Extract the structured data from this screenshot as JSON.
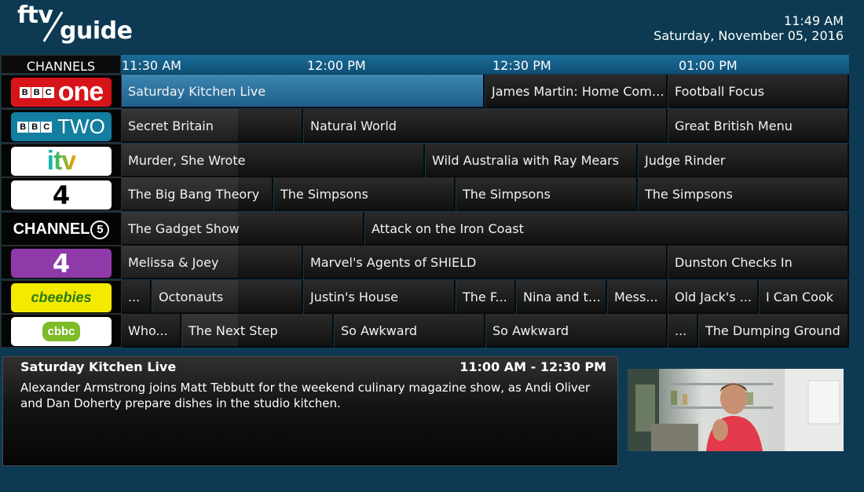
{
  "app": {
    "logo_top": "ftv",
    "logo_bottom": "guide"
  },
  "clock": {
    "time": "11:49 AM",
    "date": "Saturday, November 05, 2016"
  },
  "grid": {
    "channels_header": "CHANNELS",
    "times": [
      "11:30 AM",
      "12:00 PM",
      "12:30 PM",
      "01:00 PM"
    ],
    "rows": [
      {
        "channel": "BBC One",
        "logo": "bbc-one-logo",
        "programmes": [
          {
            "title": "Saturday Kitchen Live",
            "selected": true
          },
          {
            "title": "James Martin: Home Comfort..."
          },
          {
            "title": "Football Focus"
          }
        ]
      },
      {
        "channel": "BBC Two",
        "logo": "bbc-two-logo",
        "programmes": [
          {
            "title": "Secret Britain"
          },
          {
            "title": "Natural World"
          },
          {
            "title": "Great British Menu"
          }
        ]
      },
      {
        "channel": "ITV",
        "logo": "itv-logo",
        "programmes": [
          {
            "title": "Murder, She Wrote"
          },
          {
            "title": "Wild Australia with Ray Mears"
          },
          {
            "title": "Judge Rinder"
          }
        ]
      },
      {
        "channel": "Channel 4",
        "logo": "channel-4-logo",
        "programmes": [
          {
            "title": "The Big Bang Theory"
          },
          {
            "title": "The Simpsons"
          },
          {
            "title": "The Simpsons"
          },
          {
            "title": "The Simpsons"
          }
        ]
      },
      {
        "channel": "Channel 5",
        "logo": "channel-5-logo",
        "programmes": [
          {
            "title": "The Gadget Show"
          },
          {
            "title": "Attack on the Iron Coast"
          }
        ]
      },
      {
        "channel": "E4",
        "logo": "e4-logo",
        "programmes": [
          {
            "title": "Melissa & Joey"
          },
          {
            "title": "Marvel's Agents of SHIELD"
          },
          {
            "title": "Dunston Checks In"
          }
        ]
      },
      {
        "channel": "CBeebies",
        "logo": "cbeebies-logo",
        "programmes": [
          {
            "title": "..."
          },
          {
            "title": "Octonauts"
          },
          {
            "title": "Justin's House"
          },
          {
            "title": "The F..."
          },
          {
            "title": "Nina and th..."
          },
          {
            "title": "Mess..."
          },
          {
            "title": "Old Jack's ..."
          },
          {
            "title": "I Can Cook"
          }
        ]
      },
      {
        "channel": "CBBC",
        "logo": "cbbc-logo",
        "programmes": [
          {
            "title": "Who..."
          },
          {
            "title": "The Next Step"
          },
          {
            "title": "So Awkward"
          },
          {
            "title": "So Awkward"
          },
          {
            "title": "..."
          },
          {
            "title": "The Dumping Ground"
          }
        ]
      }
    ]
  },
  "logos": {
    "bbc_letters": [
      "B",
      "B",
      "C"
    ],
    "one": "one",
    "two": "TWO",
    "itv": "itv",
    "c4": "4",
    "c5_word": "CHANNEL",
    "c5_num": "5",
    "e4": "4",
    "cbeebies": "cbeebies",
    "cbbc": "cbbc"
  },
  "info": {
    "title": "Saturday Kitchen Live",
    "time": "11:00 AM - 12:30 PM",
    "description": "Alexander Armstrong joins Matt Tebbutt for the weekend culinary magazine show, as Andi Oliver and Dan Doherty prepare dishes in the studio kitchen."
  },
  "colors": {
    "background": "#0d3a52",
    "selected": "#2f7aa8",
    "timebar": "#1b6d99"
  }
}
